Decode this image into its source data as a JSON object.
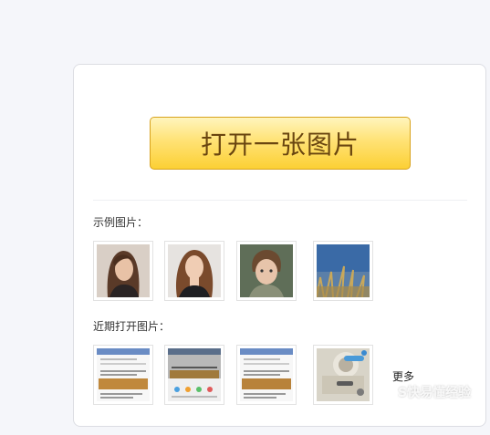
{
  "open_button": {
    "label": "打开一张图片"
  },
  "examples": {
    "label": "示例图片："
  },
  "recent": {
    "label": "近期打开图片：",
    "more_label": "更多"
  },
  "watermark": {
    "text": "S快易懂经验"
  },
  "colors": {
    "button_top": "#fff5bd",
    "button_bottom": "#fcd034",
    "button_text": "#6a4610",
    "panel_border": "#dcdde3"
  },
  "icons": {
    "example_images": [
      "woman-portrait-1",
      "woman-portrait-2",
      "child-portrait",
      "seaside-grass"
    ],
    "recent_images": [
      "chat-screenshot-1",
      "chat-screenshot-2",
      "chat-screenshot-3",
      "map-screenshot"
    ]
  }
}
